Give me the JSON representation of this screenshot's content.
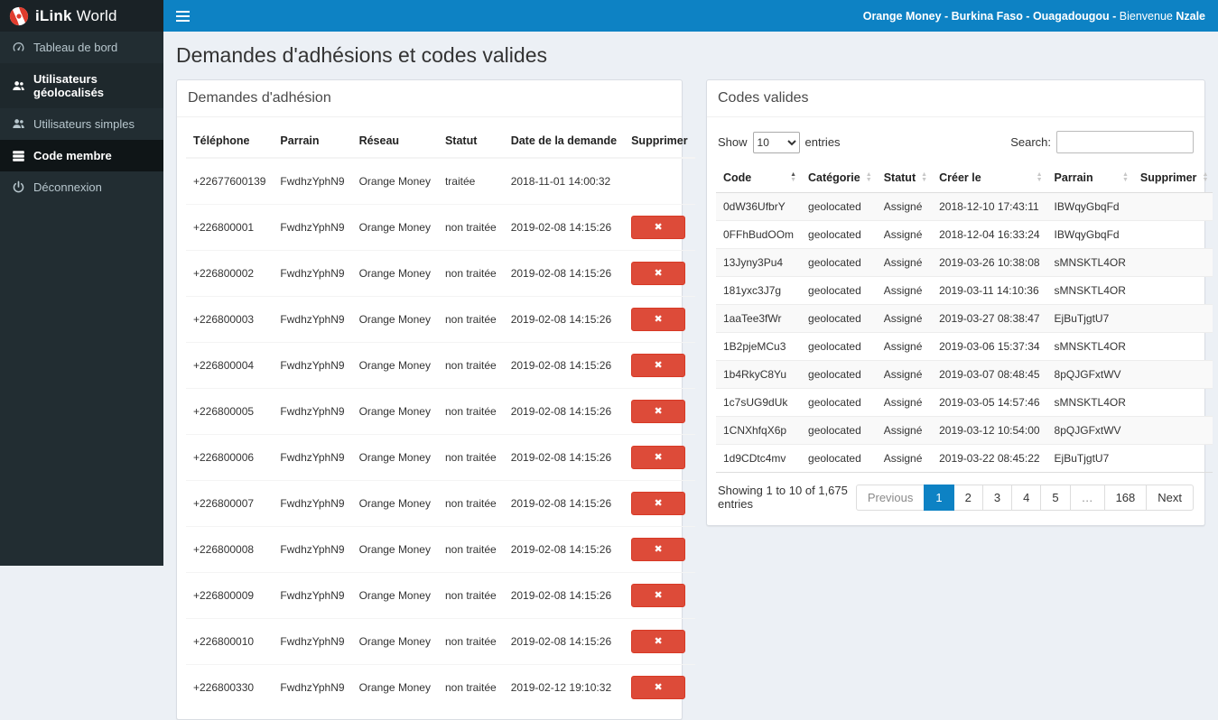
{
  "brand": {
    "bold": "iLink",
    "rest": " World"
  },
  "topbar": {
    "banner_bold": "Orange Money - Burkina Faso - Ouagadougou -",
    "banner_welcome": "Bienvenue",
    "banner_name": "Nzale"
  },
  "sidebar": {
    "items": [
      {
        "label": "Tableau de bord"
      },
      {
        "label": "Utilisateurs géolocalisés"
      },
      {
        "label": "Utilisateurs simples"
      },
      {
        "label": "Code membre"
      },
      {
        "label": "Déconnexion"
      }
    ]
  },
  "page": {
    "title": "Demandes d'adhésions et codes valides"
  },
  "requests_panel": {
    "title": "Demandes d'adhésion",
    "delete_label": "✖",
    "headers": [
      {
        "label": "Téléphone"
      },
      {
        "label": "Parrain"
      },
      {
        "label": "Réseau"
      },
      {
        "label": "Statut"
      },
      {
        "label": "Date de la demande"
      },
      {
        "label": "Supprimer"
      }
    ],
    "rows": [
      {
        "telephone": "+22677600139",
        "parrain": "FwdhzYphN9",
        "reseau": "Orange Money",
        "statut": "traitée",
        "date": "2018-11-01 14:00:32",
        "deletable": false
      },
      {
        "telephone": "+226800001",
        "parrain": "FwdhzYphN9",
        "reseau": "Orange Money",
        "statut": "non traitée",
        "date": "2019-02-08 14:15:26",
        "deletable": true
      },
      {
        "telephone": "+226800002",
        "parrain": "FwdhzYphN9",
        "reseau": "Orange Money",
        "statut": "non traitée",
        "date": "2019-02-08 14:15:26",
        "deletable": true
      },
      {
        "telephone": "+226800003",
        "parrain": "FwdhzYphN9",
        "reseau": "Orange Money",
        "statut": "non traitée",
        "date": "2019-02-08 14:15:26",
        "deletable": true
      },
      {
        "telephone": "+226800004",
        "parrain": "FwdhzYphN9",
        "reseau": "Orange Money",
        "statut": "non traitée",
        "date": "2019-02-08 14:15:26",
        "deletable": true
      },
      {
        "telephone": "+226800005",
        "parrain": "FwdhzYphN9",
        "reseau": "Orange Money",
        "statut": "non traitée",
        "date": "2019-02-08 14:15:26",
        "deletable": true
      },
      {
        "telephone": "+226800006",
        "parrain": "FwdhzYphN9",
        "reseau": "Orange Money",
        "statut": "non traitée",
        "date": "2019-02-08 14:15:26",
        "deletable": true
      },
      {
        "telephone": "+226800007",
        "parrain": "FwdhzYphN9",
        "reseau": "Orange Money",
        "statut": "non traitée",
        "date": "2019-02-08 14:15:26",
        "deletable": true
      },
      {
        "telephone": "+226800008",
        "parrain": "FwdhzYphN9",
        "reseau": "Orange Money",
        "statut": "non traitée",
        "date": "2019-02-08 14:15:26",
        "deletable": true
      },
      {
        "telephone": "+226800009",
        "parrain": "FwdhzYphN9",
        "reseau": "Orange Money",
        "statut": "non traitée",
        "date": "2019-02-08 14:15:26",
        "deletable": true
      },
      {
        "telephone": "+226800010",
        "parrain": "FwdhzYphN9",
        "reseau": "Orange Money",
        "statut": "non traitée",
        "date": "2019-02-08 14:15:26",
        "deletable": true
      },
      {
        "telephone": "+226800330",
        "parrain": "FwdhzYphN9",
        "reseau": "Orange Money",
        "statut": "non traitée",
        "date": "2019-02-12 19:10:32",
        "deletable": true
      }
    ]
  },
  "codes_panel": {
    "title": "Codes valides",
    "show_label": "Show",
    "entries_label": "entries",
    "page_length": "10",
    "search_label": "Search:",
    "search_value": "",
    "headers": [
      {
        "label": "Code",
        "state": "sorted-asc"
      },
      {
        "label": "Catégorie"
      },
      {
        "label": "Statut"
      },
      {
        "label": "Créer le"
      },
      {
        "label": "Parrain"
      },
      {
        "label": "Supprimer"
      }
    ],
    "rows": [
      {
        "code": "0dW36UfbrY",
        "categorie": "geolocated",
        "statut": "Assigné",
        "cree_le": "2018-12-10 17:43:11",
        "parrain": "IBWqyGbqFd"
      },
      {
        "code": "0FFhBudOOm",
        "categorie": "geolocated",
        "statut": "Assigné",
        "cree_le": "2018-12-04 16:33:24",
        "parrain": "IBWqyGbqFd"
      },
      {
        "code": "13Jyny3Pu4",
        "categorie": "geolocated",
        "statut": "Assigné",
        "cree_le": "2019-03-26 10:38:08",
        "parrain": "sMNSKTL4OR"
      },
      {
        "code": "181yxc3J7g",
        "categorie": "geolocated",
        "statut": "Assigné",
        "cree_le": "2019-03-11 14:10:36",
        "parrain": "sMNSKTL4OR"
      },
      {
        "code": "1aaTee3fWr",
        "categorie": "geolocated",
        "statut": "Assigné",
        "cree_le": "2019-03-27 08:38:47",
        "parrain": "EjBuTjgtU7"
      },
      {
        "code": "1B2pjeMCu3",
        "categorie": "geolocated",
        "statut": "Assigné",
        "cree_le": "2019-03-06 15:37:34",
        "parrain": "sMNSKTL4OR"
      },
      {
        "code": "1b4RkyC8Yu",
        "categorie": "geolocated",
        "statut": "Assigné",
        "cree_le": "2019-03-07 08:48:45",
        "parrain": "8pQJGFxtWV"
      },
      {
        "code": "1c7sUG9dUk",
        "categorie": "geolocated",
        "statut": "Assigné",
        "cree_le": "2019-03-05 14:57:46",
        "parrain": "sMNSKTL4OR"
      },
      {
        "code": "1CNXhfqX6p",
        "categorie": "geolocated",
        "statut": "Assigné",
        "cree_le": "2019-03-12 10:54:00",
        "parrain": "8pQJGFxtWV"
      },
      {
        "code": "1d9CDtc4mv",
        "categorie": "geolocated",
        "statut": "Assigné",
        "cree_le": "2019-03-22 08:45:22",
        "parrain": "EjBuTjgtU7"
      }
    ],
    "info": "Showing 1 to 10 of 1,675 entries",
    "pagination": [
      {
        "label": "Previous",
        "state": "disabled"
      },
      {
        "label": "1",
        "state": "active"
      },
      {
        "label": "2"
      },
      {
        "label": "3"
      },
      {
        "label": "4"
      },
      {
        "label": "5"
      },
      {
        "label": "…",
        "state": "ellipsis"
      },
      {
        "label": "168"
      },
      {
        "label": "Next"
      }
    ]
  },
  "colors": {
    "topbar_blue": "#0d82c4",
    "sidebar_dark": "#222d32",
    "danger_red": "#dd4b39",
    "content_bg": "#ecf0f5"
  }
}
